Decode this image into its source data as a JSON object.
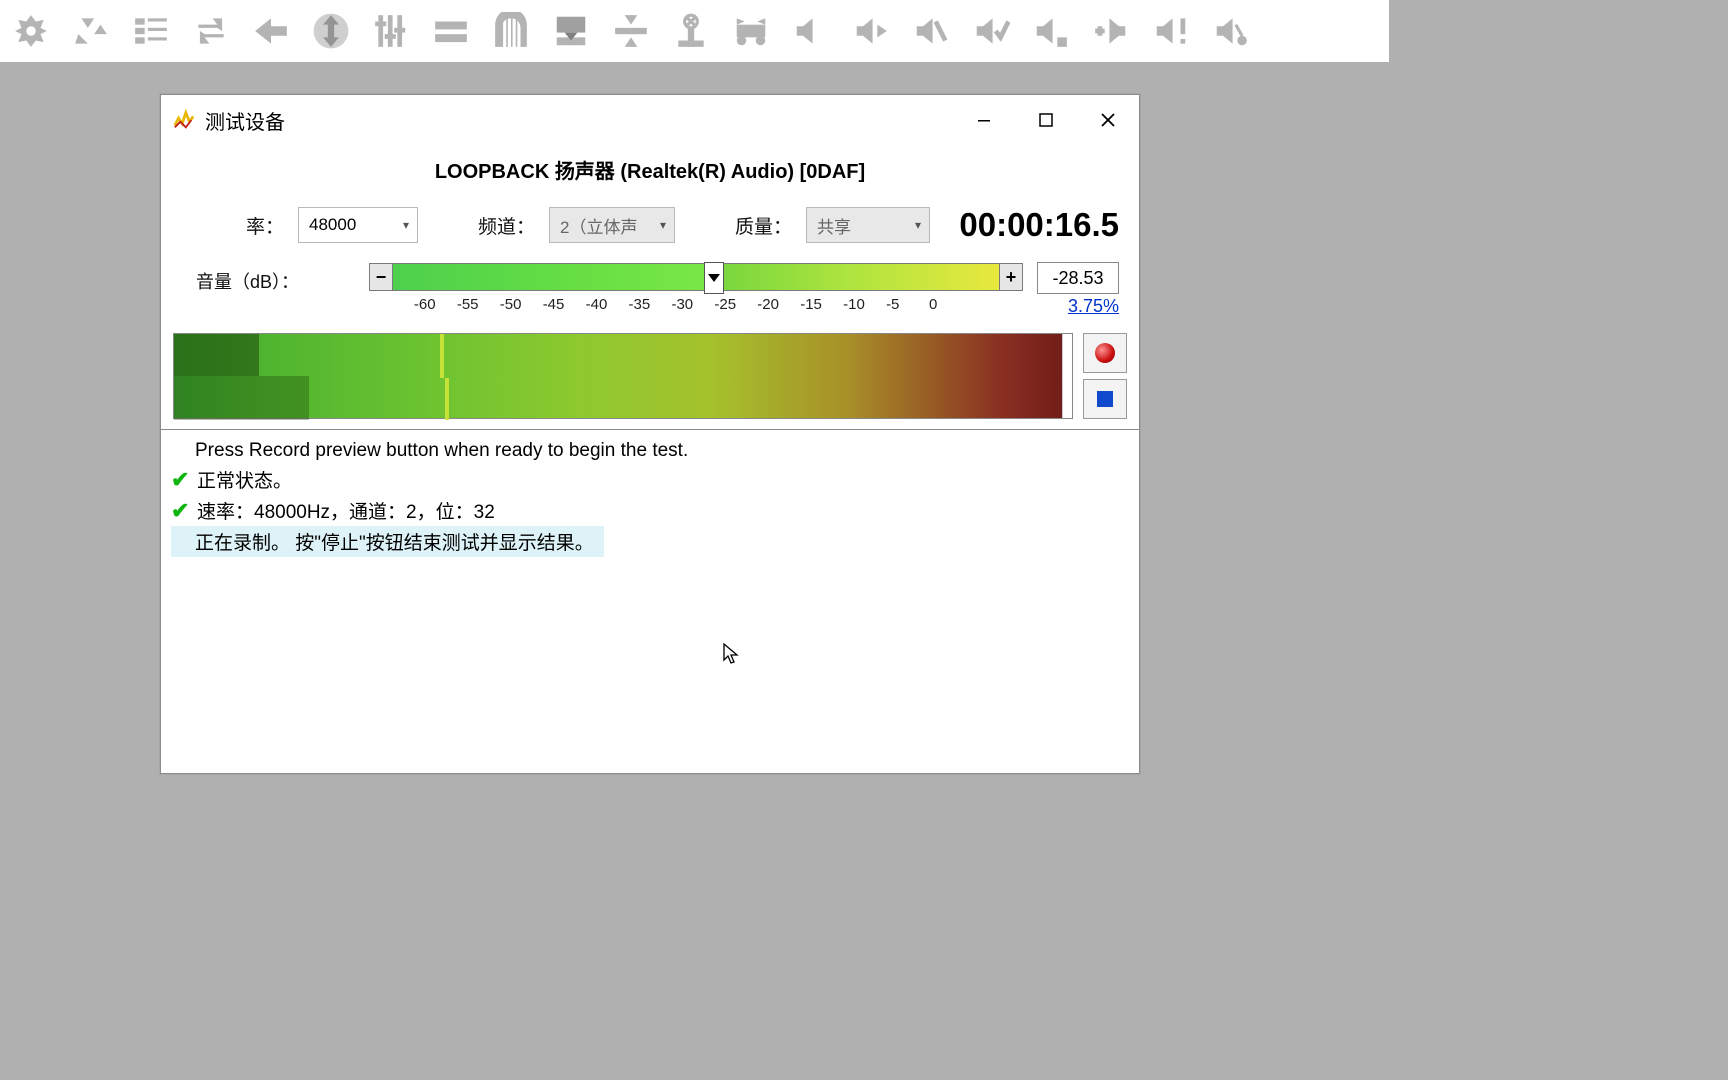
{
  "toolbar_icons": [
    "gear",
    "recycle",
    "list-indent",
    "cycle-arrows",
    "arrow-left",
    "arrows-vertical",
    "sliders",
    "equals",
    "arch",
    "compress-box",
    "collapse-center",
    "crossed-circle",
    "expand-horizontal",
    "speaker-mute",
    "speaker-right",
    "speaker-slash",
    "speaker-check",
    "speaker-bar",
    "speaker-plus-left",
    "speaker-exclaim",
    "speaker-branch"
  ],
  "dialog": {
    "title": "测试设备",
    "device_name": "LOOPBACK 扬声器 (Realtek(R) Audio) [0DAF]",
    "rate_label": "率：",
    "rate_value": "48000",
    "channel_label": "频道：",
    "channel_value": "2（立体声",
    "quality_label": "质量：",
    "quality_value": "共享",
    "timer": "00:00:16.5",
    "volume_label": "音量（dB）：",
    "volume_scale": [
      "-60",
      "-55",
      "-50",
      "-45",
      "-40",
      "-35",
      "-30",
      "-25",
      "-20",
      "-15",
      "-10",
      "-5",
      "0"
    ],
    "db_value": "-28.53",
    "pct_value": "3.75%",
    "log_intro": "Press Record preview button when ready to begin the test.",
    "log_ok1": "正常状态。",
    "log_ok2": "速率：48000Hz，通道：2，位：32",
    "log_rec": "正在录制。 按\"停止\"按钮结束测试并显示结果。"
  }
}
